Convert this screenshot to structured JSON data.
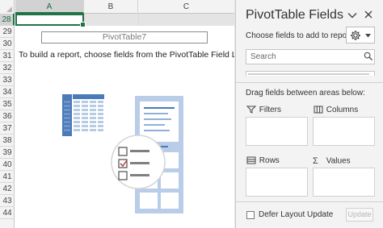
{
  "sheet": {
    "columns": [
      "A",
      "B",
      "C"
    ],
    "rows": [
      "28",
      "29",
      "30",
      "31",
      "32",
      "33",
      "34",
      "35",
      "36",
      "37",
      "38",
      "39",
      "40",
      "41",
      "42",
      "43",
      "44"
    ],
    "selected_column": "A",
    "selected_row": "28"
  },
  "pivot": {
    "name": "PivotTable7",
    "instruction": "To build a report, choose fields from the PivotTable Field List"
  },
  "pane": {
    "title": "PivotTable Fields",
    "choose_label": "Choose fields to add to report:",
    "search_placeholder": "Search",
    "drag_label": "Drag fields between areas below:",
    "areas": {
      "filters": "Filters",
      "columns": "Columns",
      "rows": "Rows",
      "values": "Values"
    },
    "defer_label": "Defer Layout Update",
    "update_button": "Update",
    "menu_icon": "chevron-down-icon",
    "close_icon": "close-icon",
    "tools_icon": "gear-icon"
  },
  "colors": {
    "excel_green": "#217346",
    "illustration_blue": "#4a7ab8",
    "illustration_light": "#c5d6ec",
    "pane_bg": "#f3f3f3",
    "check_orange": "#c0504d"
  }
}
